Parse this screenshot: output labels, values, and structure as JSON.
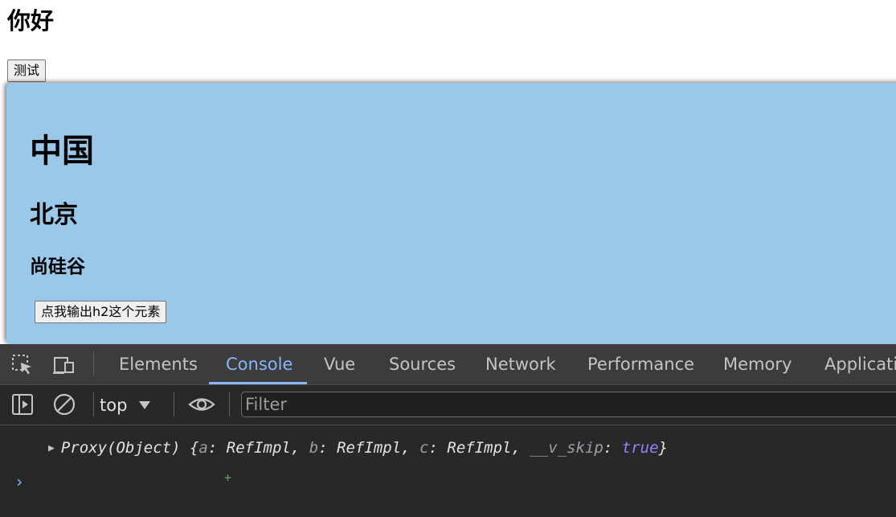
{
  "page": {
    "title": "你好",
    "test_button": "测试",
    "box": {
      "heading1": "中国",
      "heading2": "北京",
      "heading3": "尚硅谷",
      "print_button": "点我输出h2这个元素"
    },
    "box_color": "#9ac8e9"
  },
  "devtools": {
    "tabs": [
      {
        "label": "Elements"
      },
      {
        "label": "Console",
        "active": true
      },
      {
        "label": "Vue"
      },
      {
        "label": "Sources"
      },
      {
        "label": "Network"
      },
      {
        "label": "Performance"
      },
      {
        "label": "Memory"
      },
      {
        "label": "Applicatio"
      }
    ],
    "toolbar_icons": [
      "inspect-icon",
      "device-toggle-icon"
    ],
    "console_toolbar": {
      "context": "top",
      "filter_placeholder": "Filter"
    },
    "log": {
      "prefix": "Proxy(Object) {",
      "items": [
        {
          "key": "a",
          "value": "RefImpl"
        },
        {
          "key": "b",
          "value": "RefImpl"
        },
        {
          "key": "c",
          "value": "RefImpl"
        },
        {
          "key": "__v_skip",
          "value": "true"
        }
      ],
      "suffix": "}"
    },
    "prompt": "›",
    "cursor_mark": "+",
    "accent_color": "#8ab4f8"
  }
}
